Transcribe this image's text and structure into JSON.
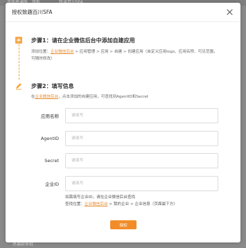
{
  "background": {
    "item1": "洗购普通版 , 领有",
    "item2": "跃迪百川SFA",
    "footer": "总邀款审批"
  },
  "dialog": {
    "title": "授权致趣百川SFA",
    "step1": {
      "title": "步骤1：请在企业微信后台中添加自建应用",
      "desc_prefix": "添加位置：",
      "link": "企业微信后台",
      "desc_suffix": " > 应用管理 > 应用 > 自建 > 创建应用（自定义应用logo、应用名称、可见范围，可随时修改）"
    },
    "step2": {
      "title": "步骤2：填写信息",
      "desc_prefix": "在",
      "link": "企业微信后台",
      "desc_suffix": "，点击添加的自建应用，可查找到AgentID和Secret"
    },
    "fields": [
      {
        "label": "应用名称",
        "placeholder": "请填写"
      },
      {
        "label": "AgentID",
        "placeholder": "请填写"
      },
      {
        "label": "Secret",
        "placeholder": "请填写"
      },
      {
        "label": "企业ID",
        "placeholder": "请填写"
      }
    ],
    "hint": {
      "line1": "如需填写企业ID，请在企业微信后台查找",
      "line2_prefix": "查找位置：",
      "link": "企业微信后台",
      "line2_suffix": " > 我的企业 > 企业信息（页面最下方）"
    },
    "submit_label": "授权"
  },
  "colors": {
    "accent": "#f28c28",
    "link": "#e68a2e",
    "overlay": "#8a8a8a"
  },
  "icons": {
    "close": "close-icon",
    "step1": "plus-square-icon",
    "step2": "pencil-icon"
  }
}
